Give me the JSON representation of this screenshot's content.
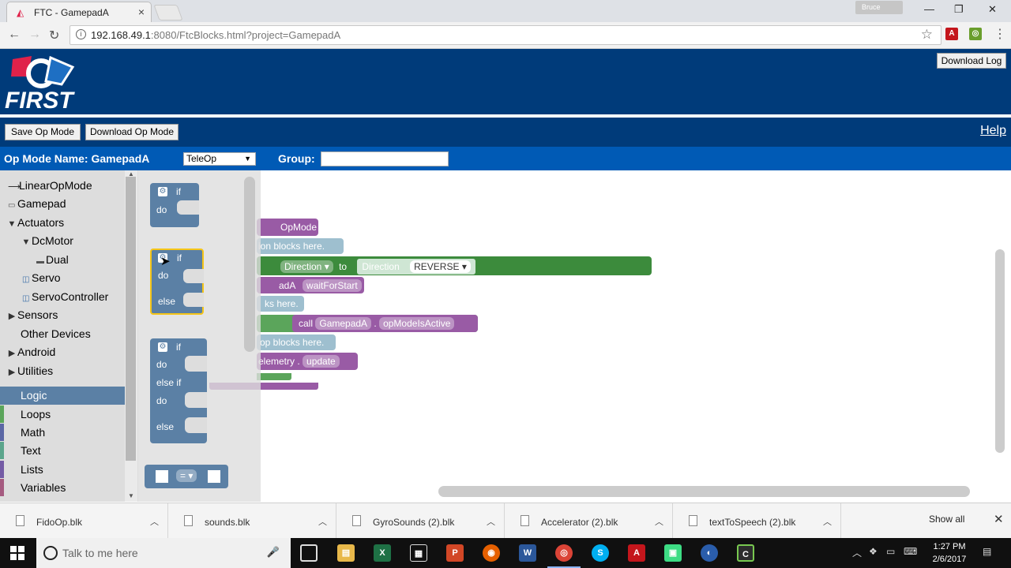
{
  "browser": {
    "tab_title": "FTC - GamepadA",
    "tab_close": "×",
    "profile_name": "Bruce",
    "url_host": "192.168.49.1",
    "url_rest": ":8080/FtcBlocks.html?project=GamepadA",
    "window_controls": [
      "—",
      "❐",
      "✕"
    ]
  },
  "header": {
    "logo_text": "FIRST",
    "download_log_label": "Download Log"
  },
  "toolbar": {
    "save_label": "Save Op Mode",
    "download_label": "Download Op Mode",
    "help_label": "Help"
  },
  "opmode": {
    "name_label": "Op Mode Name: GamepadA",
    "type_value": "TeleOp",
    "group_label": "Group:",
    "group_value": ""
  },
  "toolbox": {
    "items": [
      {
        "label": "LinearOpMode",
        "glyph": "⟶"
      },
      {
        "label": "Gamepad",
        "glyph": "🎮"
      },
      {
        "label": "Actuators",
        "glyph": "▼"
      },
      {
        "label": "DcMotor",
        "glyph": "▼"
      },
      {
        "label": "Dual",
        "glyph": "▬"
      },
      {
        "label": "Servo",
        "glyph": "◫"
      },
      {
        "label": "ServoController",
        "glyph": "◫"
      },
      {
        "label": "Sensors",
        "glyph": "▶"
      },
      {
        "label": "Other Devices",
        "glyph": ""
      },
      {
        "label": "Android",
        "glyph": "▶"
      },
      {
        "label": "Utilities",
        "glyph": "▶"
      },
      {
        "label": "Logic",
        "glyph": ""
      },
      {
        "label": "Loops",
        "glyph": ""
      },
      {
        "label": "Math",
        "glyph": ""
      },
      {
        "label": "Text",
        "glyph": ""
      },
      {
        "label": "Lists",
        "glyph": ""
      },
      {
        "label": "Variables",
        "glyph": ""
      }
    ],
    "category_colors": {
      "logic": "#5b80a5",
      "loops": "#5ba55b",
      "math": "#5b67a5",
      "text": "#5ba58c",
      "lists": "#745ba5",
      "variables": "#a55b80"
    },
    "selected": "Logic"
  },
  "flyout": {
    "if_label": "if",
    "do_label": "do",
    "else_label": "else",
    "elseif_label": "else if",
    "compare_label": "="
  },
  "blocks": {
    "opmode_frag": "OpMode",
    "init_comment": "ion blocks here.",
    "direction_label": "Direction",
    "to_label": "to",
    "direction_enum": "Direction",
    "reverse_value": "REVERSE",
    "gamepad_frag": "adA",
    "wait_for_start": "waitForStart",
    "run_comment": "ks here.",
    "call_label": "call",
    "gamepad_a": "GamepadA",
    "op_mode_is_active": "opModeIsActive",
    "loop_comment": "op blocks here.",
    "telemetry_frag": "elemetry",
    "update_label": "update"
  },
  "downloads": {
    "files": [
      "FidoOp.blk",
      "sounds.blk",
      "GyroSounds (2).blk",
      "Accelerator (2).blk",
      "textToSpeech (2).blk"
    ],
    "show_all_label": "Show all"
  },
  "taskbar": {
    "search_placeholder": "Talk to me here",
    "time": "1:27 PM",
    "date": "2/6/2017"
  }
}
